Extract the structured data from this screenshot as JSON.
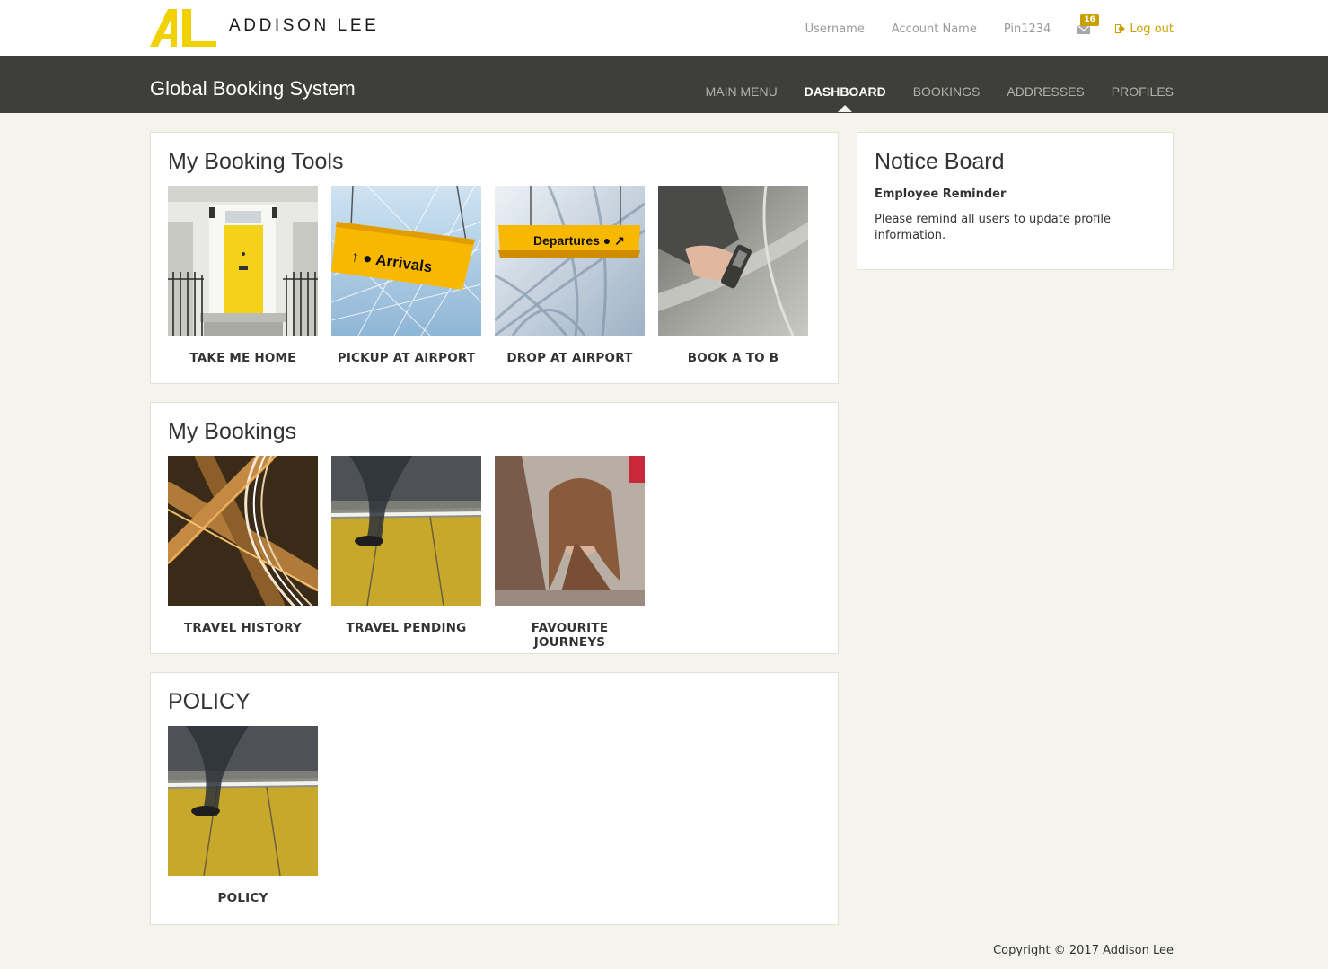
{
  "header": {
    "logo_text": "ADDISON LEE",
    "username": "Username",
    "account_name": "Account Name",
    "pin": "Pin1234",
    "messages_count": "16",
    "logout": "Log out",
    "accent_color": "#c8a000"
  },
  "navbar": {
    "brand": "Global Booking System",
    "items": [
      {
        "label": "MAIN MENU",
        "active": false
      },
      {
        "label": "DASHBOARD",
        "active": true
      },
      {
        "label": "BOOKINGS",
        "active": false
      },
      {
        "label": "ADDRESSES",
        "active": false
      },
      {
        "label": "PROFILES",
        "active": false
      }
    ]
  },
  "booking_tools": {
    "title": "My Booking Tools",
    "tiles": [
      {
        "label": "TAKE ME HOME",
        "image": "yellow-door-image"
      },
      {
        "label": "PICKUP AT AIRPORT",
        "image": "arrivals-sign-image",
        "sign_text": "Arrivals"
      },
      {
        "label": "DROP AT AIRPORT",
        "image": "departures-sign-image",
        "sign_text": "Departures"
      },
      {
        "label": "BOOK A TO B",
        "image": "car-door-hand-image"
      }
    ]
  },
  "my_bookings": {
    "title": "My Bookings",
    "tiles": [
      {
        "label": "TRAVEL HISTORY",
        "image": "light-trails-image"
      },
      {
        "label": "TRAVEL PENDING",
        "image": "walking-platform-image"
      },
      {
        "label": "FAVOURITE JOURNEYS",
        "image": "passenger-window-image"
      }
    ]
  },
  "policy": {
    "title": "POLICY",
    "tiles": [
      {
        "label": "POLICY",
        "image": "walking-platform-image"
      }
    ]
  },
  "notice_board": {
    "title": "Notice Board",
    "heading": "Employee Reminder",
    "body": "Please remind all users to update profile information."
  },
  "footer": {
    "copyright": "Copyright © 2017 Addison Lee"
  }
}
